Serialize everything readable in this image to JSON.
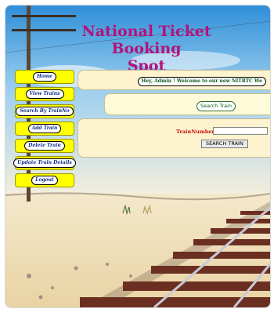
{
  "page": {
    "title_line1": "National Ticket Booking",
    "title_line2": "Spot"
  },
  "nav": [
    {
      "label": "Home"
    },
    {
      "label": "View Trains"
    },
    {
      "label": "Search By TrainNo"
    },
    {
      "label": "Add Train"
    },
    {
      "label": "Delete Train"
    },
    {
      "label": "Update Train Details"
    },
    {
      "label": "Logout"
    }
  ],
  "welcome": {
    "text": "Hey, Admin ! Welcome to our new NITRTC We"
  },
  "search_train": {
    "label": "Search Train"
  },
  "search_form": {
    "label": "TrainNumber:",
    "value": "",
    "button": "SEARCH TRAIN"
  },
  "colors": {
    "title": "#b3127a",
    "nav_bg": "#ffff00",
    "panel_bg": "#fdf3cf"
  }
}
